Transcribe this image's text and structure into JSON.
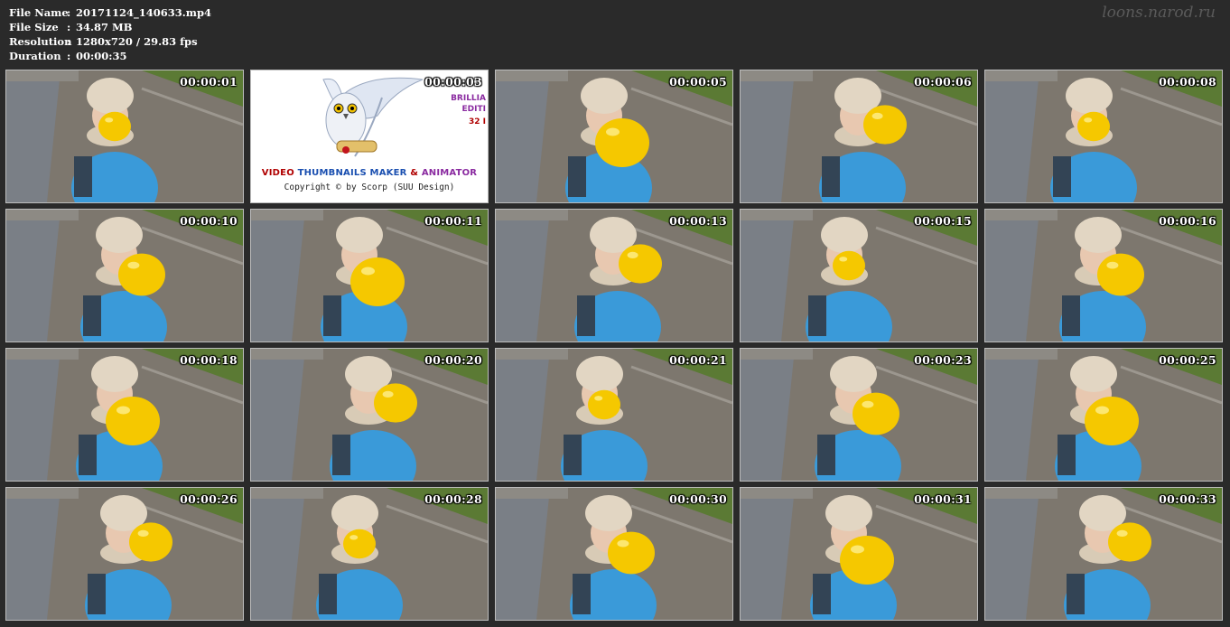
{
  "info": {
    "rows": [
      {
        "label": "File Name",
        "sep": ":",
        "value": "20171124_140633.mp4"
      },
      {
        "label": "File Size",
        "sep": ":",
        "value": "34.87 MB"
      },
      {
        "label": "Resolution",
        "sep": ":",
        "value": "1280x720 / 29.83 fps"
      },
      {
        "label": "Duration",
        "sep": ":",
        "value": "00:00:35"
      }
    ]
  },
  "watermark": "loons.narod.ru",
  "logo": {
    "title_part1": "VIDEO ",
    "title_part2": "THUMBNAILS MAKER",
    "title_part3": " & ",
    "title_part4": "ANIMATOR",
    "copyright": "Copyright © by Scorp (SUU Design)",
    "right_line1": "BRILLIA",
    "right_line2": "EDITI",
    "right_line3": "32 I"
  },
  "thumbnails": [
    {
      "time": "00:00:01"
    },
    {
      "time": "00:00:03"
    },
    {
      "time": "00:00:05"
    },
    {
      "time": "00:00:06"
    },
    {
      "time": "00:00:08"
    },
    {
      "time": "00:00:10"
    },
    {
      "time": "00:00:11"
    },
    {
      "time": "00:00:13"
    },
    {
      "time": "00:00:15"
    },
    {
      "time": "00:00:16"
    },
    {
      "time": "00:00:18"
    },
    {
      "time": "00:00:20"
    },
    {
      "time": "00:00:21"
    },
    {
      "time": "00:00:23"
    },
    {
      "time": "00:00:25"
    },
    {
      "time": "00:00:26"
    },
    {
      "time": "00:00:28"
    },
    {
      "time": "00:00:30"
    },
    {
      "time": "00:00:31"
    },
    {
      "time": "00:00:33"
    }
  ],
  "colors": {
    "background": "#2a2a2a",
    "balloon": "#f5c800",
    "jacket": "#3a9ad9",
    "hat": "#e2d6c3",
    "wall": "#7a7f86",
    "pavement": "#7d776e",
    "grass": "#5b7a34",
    "logo_red": "#b00000",
    "logo_blue": "#1a4fb0",
    "logo_purple": "#8a2aa0"
  }
}
